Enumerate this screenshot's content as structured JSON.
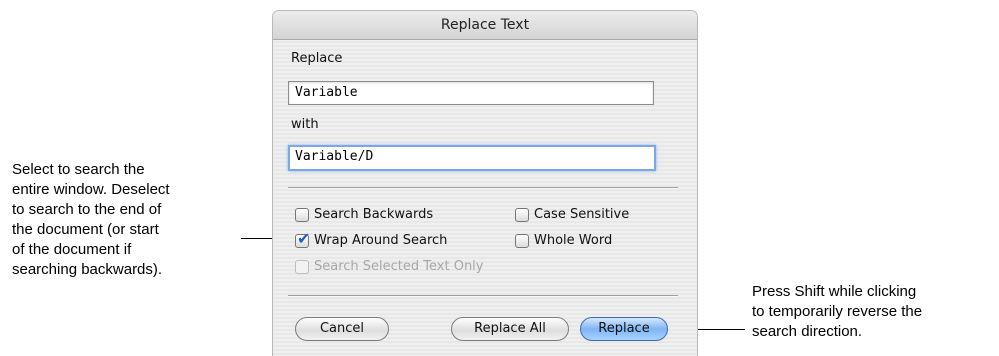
{
  "dialog": {
    "title": "Replace Text",
    "replace_label": "Replace",
    "replace_value": "Variable",
    "with_label": "with",
    "with_value": "Variable/D",
    "checkboxes": {
      "search_backwards": {
        "label": "Search Backwards",
        "checked": false
      },
      "case_sensitive": {
        "label": "Case Sensitive",
        "checked": false
      },
      "wrap_around": {
        "label": "Wrap Around Search",
        "checked": true
      },
      "whole_word": {
        "label": "Whole Word",
        "checked": false
      },
      "selected_only": {
        "label": "Search Selected Text Only",
        "checked": false,
        "disabled": true
      }
    },
    "buttons": {
      "cancel": "Cancel",
      "replace_all": "Replace All",
      "replace": "Replace"
    }
  },
  "callouts": {
    "left": [
      "Select to search the",
      "entire window. Deselect",
      "to search to the end of",
      "the document (or start",
      "of the document if",
      "searching backwards)."
    ],
    "right": [
      "Press Shift while clicking",
      "to temporarily reverse the",
      "search direction."
    ]
  },
  "colors": {
    "default_button": "#7fb6f4",
    "checkmark": "#1f5fbf",
    "focus_ring": "#7aa8e6"
  }
}
